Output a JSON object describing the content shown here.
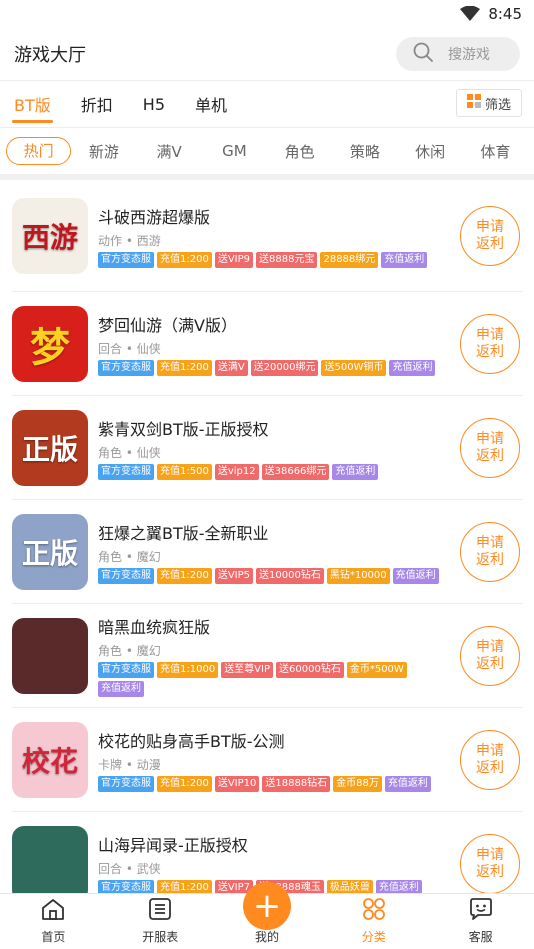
{
  "status": {
    "time": "8:45"
  },
  "header": {
    "title": "游戏大厅",
    "search_placeholder": "搜游戏"
  },
  "primary_tabs": [
    "BT版",
    "折扣",
    "H5",
    "单机"
  ],
  "filter_label": "筛选",
  "sub_tabs": [
    "热门",
    "新游",
    "满V",
    "GM",
    "角色",
    "策略",
    "休闲",
    "体育"
  ],
  "rebate_label": "申请返利",
  "tag_colors": {
    "blue": "#4aa3f0",
    "orange": "#f7a21b",
    "red": "#f06a6a",
    "purple": "#a788e8",
    "accent": "#ff8a1f"
  },
  "games": [
    {
      "name": "斗破西游超爆版",
      "meta": "动作 • 西游",
      "glyph": "西游",
      "icon_bg": "#f4efe6",
      "glyph_color": "#c0171f",
      "tags": [
        [
          "官方变态服",
          "blue"
        ],
        [
          "充值1:200",
          "orange"
        ],
        [
          "送VIP9",
          "red"
        ],
        [
          "送8888元宝",
          "red"
        ],
        [
          "28888绑元",
          "orange"
        ],
        [
          "充值返利",
          "purple"
        ]
      ]
    },
    {
      "name": "梦回仙游（满V版）",
      "meta": "回合 • 仙侠",
      "glyph": "梦",
      "icon_bg": "#d8201a",
      "glyph_color": "#ffd21f",
      "tags": [
        [
          "官方变态服",
          "blue"
        ],
        [
          "充值1:200",
          "orange"
        ],
        [
          "送满V",
          "red"
        ],
        [
          "送20000绑元",
          "red"
        ],
        [
          "送500W铜币",
          "orange"
        ],
        [
          "充值返利",
          "purple"
        ]
      ]
    },
    {
      "name": "紫青双剑BT版-正版授权",
      "meta": "角色 • 仙侠",
      "glyph": "正版",
      "icon_bg": "#b23a1f",
      "glyph_color": "#ffffff",
      "tags": [
        [
          "官方变态服",
          "blue"
        ],
        [
          "充值1:500",
          "orange"
        ],
        [
          "送vip12",
          "red"
        ],
        [
          "送38666绑元",
          "red"
        ],
        [
          "充值返利",
          "purple"
        ]
      ]
    },
    {
      "name": "狂爆之翼BT版-全新职业",
      "meta": "角色 • 魔幻",
      "glyph": "正版",
      "icon_bg": "#8fa3c9",
      "glyph_color": "#ffffff",
      "tags": [
        [
          "官方变态服",
          "blue"
        ],
        [
          "充值1:200",
          "orange"
        ],
        [
          "送VIP5",
          "red"
        ],
        [
          "送10000钻石",
          "red"
        ],
        [
          "黑钻*10000",
          "orange"
        ],
        [
          "充值返利",
          "purple"
        ]
      ]
    },
    {
      "name": "暗黑血统疯狂版",
      "meta": "角色 • 魔幻",
      "glyph": "",
      "icon_bg": "#5a2a2a",
      "glyph_color": "#ffffff",
      "tags": [
        [
          "官方变态服",
          "blue"
        ],
        [
          "充值1:1000",
          "orange"
        ],
        [
          "送至尊VIP",
          "red"
        ],
        [
          "送60000钻石",
          "red"
        ],
        [
          "金币*500W",
          "orange"
        ],
        [
          "充值返利",
          "purple"
        ]
      ]
    },
    {
      "name": "校花的贴身高手BT版-公测",
      "meta": "卡牌 • 动漫",
      "glyph": "校花",
      "icon_bg": "#f6c9d2",
      "glyph_color": "#d0263a",
      "tags": [
        [
          "官方变态服",
          "blue"
        ],
        [
          "充值1:200",
          "orange"
        ],
        [
          "送VIP10",
          "red"
        ],
        [
          "送18888钻石",
          "red"
        ],
        [
          "金币88万",
          "orange"
        ],
        [
          "充值返利",
          "purple"
        ]
      ]
    },
    {
      "name": "山海异闻录-正版授权",
      "meta": "回合 • 武侠",
      "glyph": "",
      "icon_bg": "#2f6b5c",
      "glyph_color": "#ffffff",
      "tags": [
        [
          "官方变态服",
          "blue"
        ],
        [
          "充值1:200",
          "orange"
        ],
        [
          "送VIP7",
          "red"
        ],
        [
          "送18888魂玉",
          "red"
        ],
        [
          "极品妖兽",
          "orange"
        ],
        [
          "充值返利",
          "purple"
        ]
      ]
    }
  ],
  "bottom_nav": [
    {
      "label": "首页",
      "icon": "home-icon"
    },
    {
      "label": "开服表",
      "icon": "list-icon"
    },
    {
      "label": "我的",
      "icon": "plus-icon"
    },
    {
      "label": "分类",
      "icon": "category-icon"
    },
    {
      "label": "客服",
      "icon": "service-icon"
    }
  ]
}
